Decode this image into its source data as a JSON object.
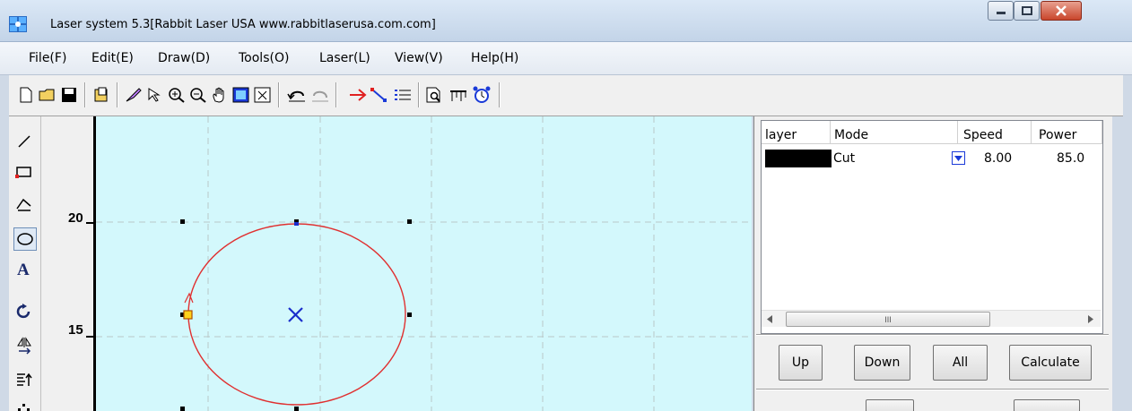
{
  "window": {
    "title": "Laser system 5.3[Rabbit Laser USA www.rabbitlaserusa.com.com]",
    "icon": "app-logo-icon",
    "buttons": {
      "minimize": "minimize-icon",
      "maximize": "maximize-icon",
      "close": "close-icon"
    }
  },
  "menu": [
    "File(F)",
    "Edit(E)",
    "Draw(D)",
    "Tools(O)",
    "Laser(L)",
    "View(V)",
    "Help(H)"
  ],
  "toolbar": [
    "new-file-icon",
    "open-folder-icon",
    "save-icon",
    "import-icon",
    "brush-icon",
    "select-icon",
    "zoom-in-icon",
    "zoom-out-icon",
    "pan-hand-icon",
    "fit-page-icon",
    "fit-selection-icon",
    "undo-icon",
    "redo-icon",
    "cut-path-icon",
    "node-edit-icon",
    "array-icon",
    "preview-icon",
    "measure-icon",
    "timer-icon"
  ],
  "tools": [
    "line-tool-icon",
    "rectangle-tool-icon",
    "polyline-tool-icon",
    "ellipse-tool-icon",
    "text-tool-icon",
    "rotate-tool-icon",
    "mirror-tool-icon",
    "align-tool-icon",
    "dots-tool-icon"
  ],
  "ruler": {
    "labels": [
      "20",
      "15"
    ]
  },
  "layers": {
    "columns": [
      "layer",
      "Mode",
      "Speed",
      "Power"
    ],
    "rows": [
      {
        "color": "#000000",
        "mode": "Cut",
        "speed": "8.00",
        "power": "85.0"
      }
    ],
    "scroll_thumb_label": "III"
  },
  "panel_buttons": {
    "up": "Up",
    "down": "Down",
    "all": "All",
    "calculate": "Calculate"
  },
  "colors": {
    "canvas_bg": "#d3f8fc",
    "shape_stroke": "#e03030",
    "center_mark": "#1a2ecc",
    "grid": "#b8c8c8"
  }
}
